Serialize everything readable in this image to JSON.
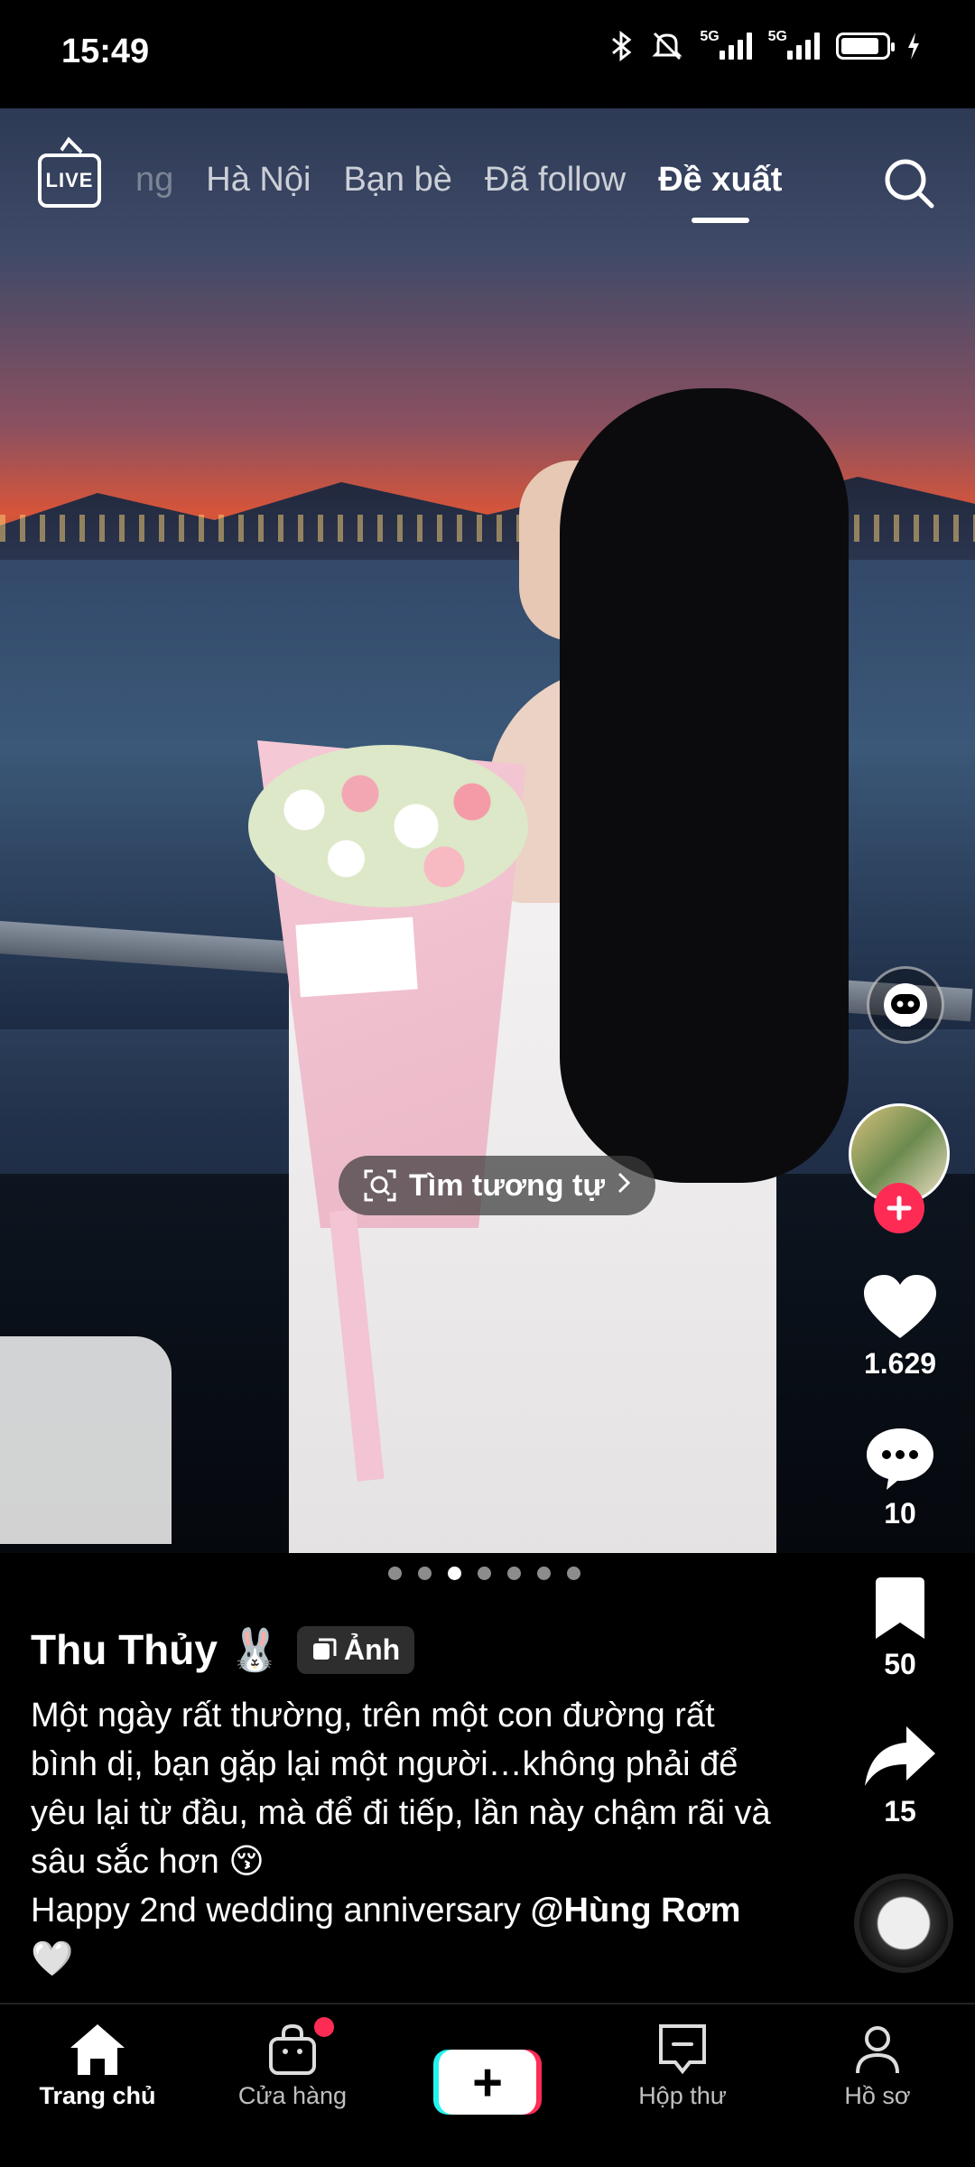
{
  "status_bar": {
    "time": "15:49",
    "network_1": "5G",
    "network_2": "5G",
    "battery_level": 0.85
  },
  "top_nav": {
    "live_label": "LIVE",
    "tabs": [
      {
        "label": "ng",
        "state": "faded"
      },
      {
        "label": "Hà Nội",
        "state": "normal"
      },
      {
        "label": "Bạn bè",
        "state": "normal"
      },
      {
        "label": "Đã follow",
        "state": "normal"
      },
      {
        "label": "Đề xuất",
        "state": "active"
      }
    ]
  },
  "find_similar_label": "Tìm tương tự",
  "actions": {
    "likes": "1.629",
    "comments": "10",
    "saves": "50",
    "shares": "15"
  },
  "carousel": {
    "total": 7,
    "active_index": 2
  },
  "post": {
    "author": "Thu Thủy 🐰",
    "badge_label": "Ảnh",
    "caption_line_1": "Một ngày rất thường, trên một con đường rất bình dị, bạn gặp lại một người…không phải để yêu lại từ đầu, mà để đi tiếp, lần này chậm rãi và sâu sắc hơn 😚",
    "caption_line_2": "Happy 2nd wedding anniversary ",
    "mention": "@Hùng Rơm",
    "caption_end": " 🤍"
  },
  "bottom_nav": {
    "home": "Trang chủ",
    "shop": "Cửa hàng",
    "inbox": "Hộp thư",
    "profile": "Hồ sơ"
  },
  "colors": {
    "accent_red": "#fe2c55",
    "accent_cyan": "#25f4ee"
  }
}
